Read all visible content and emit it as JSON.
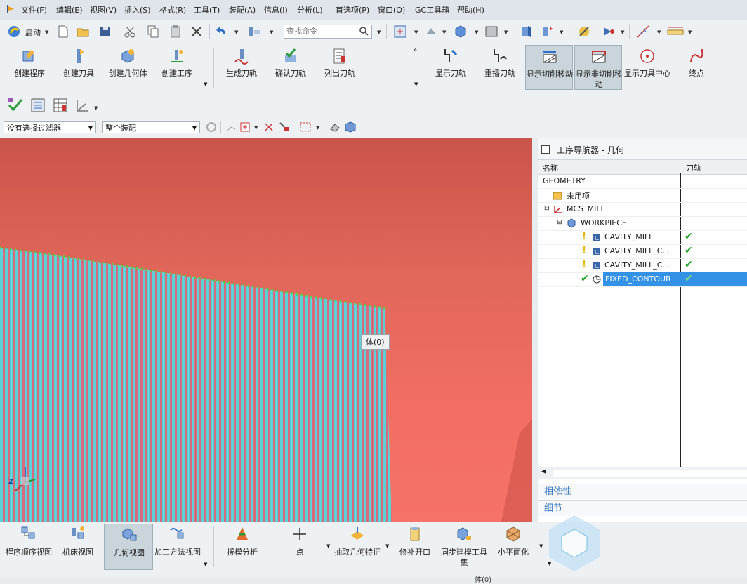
{
  "menu": [
    "文件(F)",
    "编辑(E)",
    "视图(V)",
    "插入(S)",
    "格式(R)",
    "工具(T)",
    "装配(A)",
    "信息(I)",
    "分析(L)",
    "首选项(P)",
    "窗口(O)",
    "GC工具箱",
    "帮助(H)"
  ],
  "std_toolbar": {
    "start_label": "启动",
    "search_placeholder": "查找命令"
  },
  "ribbon": {
    "group1": [
      "创建程序",
      "创建刀具",
      "创建几何体",
      "创建工序"
    ],
    "group2": [
      "生成刀轨",
      "确认刀轨",
      "列出刀轨"
    ],
    "group3": [
      "显示刀轨",
      "重播刀轨",
      "显示切削移动",
      "显示非切削移动",
      "显示刀具中心",
      "终点"
    ]
  },
  "filter": {
    "selection_filter": "没有选择过滤器",
    "scope": "整个装配"
  },
  "viewport": {
    "tooltip": "体(0)",
    "axis_label": "Z"
  },
  "navigator": {
    "title": "工序导航器 - 几何",
    "col_name": "名称",
    "col_path": "刀轨",
    "rows": [
      {
        "name": "GEOMETRY",
        "path": ""
      },
      {
        "name": "未用项",
        "path": ""
      },
      {
        "name": "MCS_MILL",
        "path": ""
      },
      {
        "name": "WORKPIECE",
        "path": ""
      },
      {
        "name": "CAVITY_MILL",
        "path": "✔"
      },
      {
        "name": "CAVITY_MILL_C...",
        "path": "✔"
      },
      {
        "name": "CAVITY_MILL_C...",
        "path": "✔"
      },
      {
        "name": "FIXED_CONTOUR",
        "path": "✔"
      }
    ],
    "sections": [
      "相依性",
      "细节"
    ]
  },
  "bottom_toolbar": [
    "程序顺序视图",
    "机床视图",
    "几何视图",
    "加工方法视图",
    "拔模分析",
    "点",
    "抽取几何特征",
    "修补开口",
    "同步建模工具集",
    "小平面化"
  ],
  "status_text": "体(0)",
  "colors": {
    "accent": "#3392e6",
    "viewport_top": "#c9544a",
    "viewport_bottom": "#f6736a",
    "toolpath": "#5ad2d6",
    "check": "#1aa320"
  }
}
